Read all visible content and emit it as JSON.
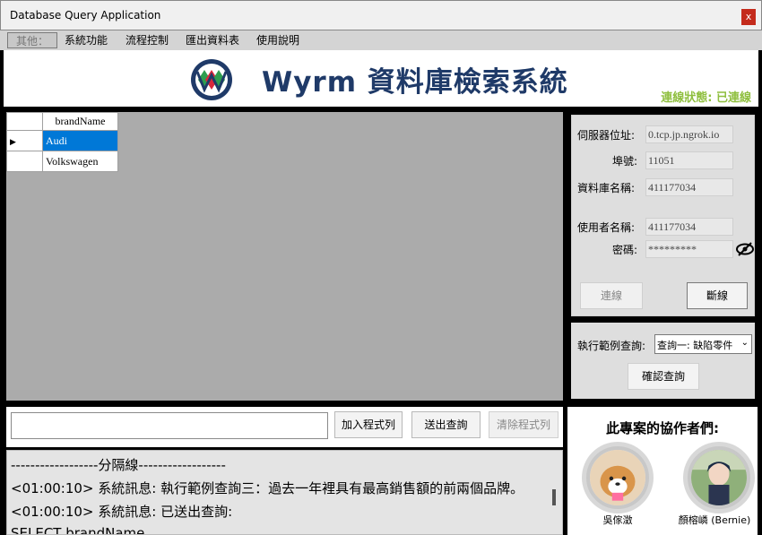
{
  "window": {
    "title": "Database Query Application",
    "close_glyph": "x"
  },
  "menu": {
    "items": [
      {
        "label": "其他："
      },
      {
        "label": "系統功能"
      },
      {
        "label": "流程控制"
      },
      {
        "label": "匯出資料表"
      },
      {
        "label": "使用說明"
      }
    ]
  },
  "banner": {
    "title": "Wyrm 資料庫檢索系統",
    "connection_status": "連線狀態: 已連線",
    "logo_icon": "wyrm-logo-icon",
    "status_color": "#8fbf3f",
    "title_color": "#1f3a68"
  },
  "grid": {
    "column_header": "brandName",
    "rows": [
      {
        "value": "Audi",
        "selected": true
      },
      {
        "value": "Volkswagen",
        "selected": false
      }
    ],
    "selection_color": "#0078d7"
  },
  "connection": {
    "server_label": "伺服器位址:",
    "server_value": "0.tcp.jp.ngrok.io",
    "port_label": "埠號:",
    "port_value": "11051",
    "db_label": "資料庫名稱:",
    "db_value": "411177034",
    "user_label": "使用者名稱:",
    "user_value": "411177034",
    "password_label": "密碼:",
    "password_value": "*********",
    "connect_button": "連線",
    "disconnect_button": "斷線",
    "eye_icon": "eye-slash-icon"
  },
  "query": {
    "label": "執行範例查詢:",
    "selected_option": "查詢一: 缺陷零件",
    "confirm_button": "確認查詢"
  },
  "command": {
    "input_value": "",
    "add_button": "加入程式列",
    "send_button": "送出查詢",
    "clear_button": "清除程式列"
  },
  "log": {
    "lines": [
      "------------------分隔線------------------",
      "<01:00:10> 系統訊息: 執行範例查詢三：過去一年裡具有最高銷售額的前兩個品牌。",
      "<01:00:10> 系統訊息: 已送出查詢:",
      "SELECT brandName"
    ]
  },
  "collaborators": {
    "title": "此專案的協作者們:",
    "people": [
      {
        "name": "吳傢澂"
      },
      {
        "name": "顏榕嶙 (Bernie)"
      }
    ]
  }
}
